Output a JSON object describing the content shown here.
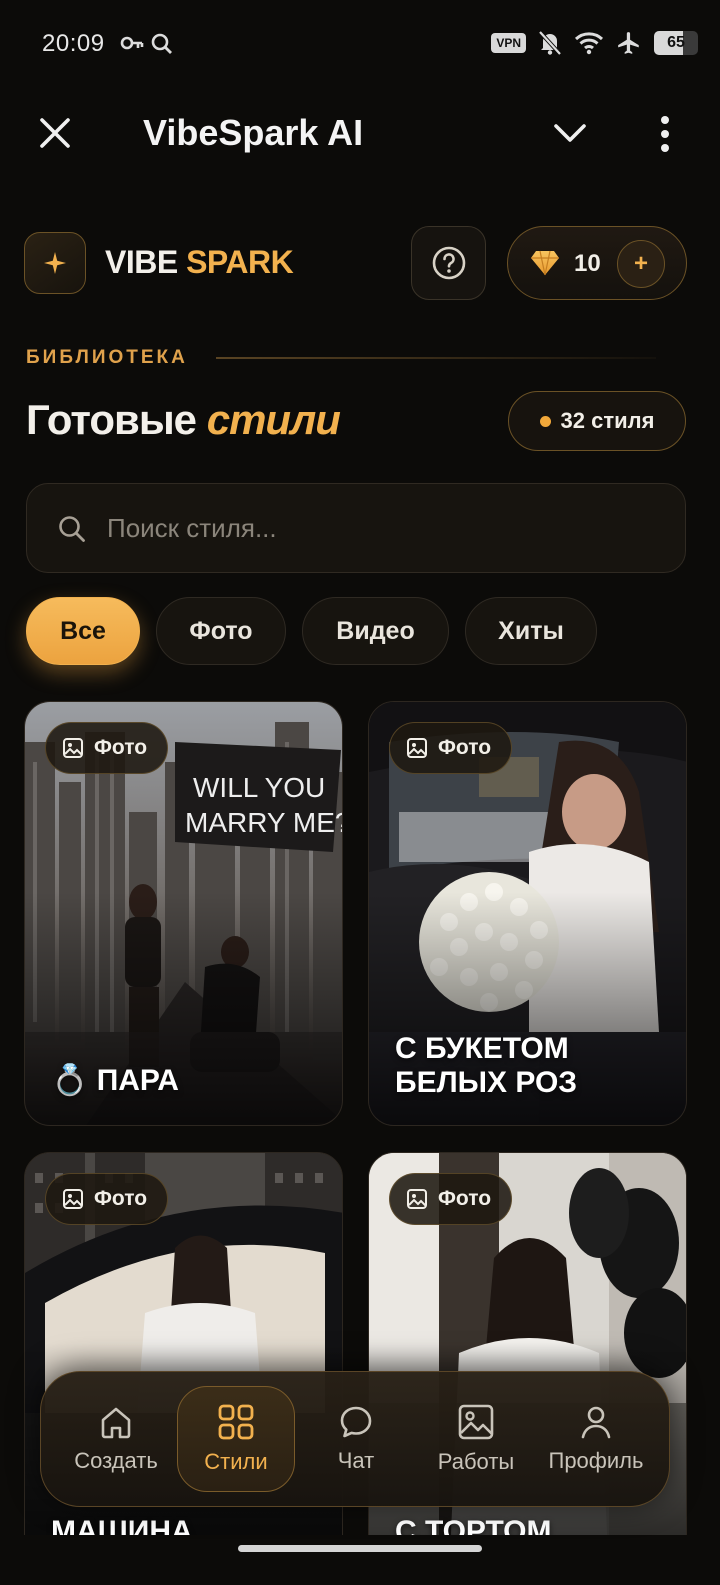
{
  "status_bar": {
    "time": "20:09",
    "vpn_label": "VPN",
    "battery": "65",
    "battery_level": 0.65
  },
  "header": {
    "title": "VibeSpark AI"
  },
  "brand": {
    "word_a": "VIBE",
    "word_b": "SPARK",
    "credits": "10",
    "add_symbol": "+"
  },
  "library": {
    "eyebrow": "БИБЛИОТЕКА",
    "heading_a": "Готовые",
    "heading_b": "стили",
    "count": "32 стиля"
  },
  "search": {
    "placeholder": "Поиск стиля..."
  },
  "filters": [
    {
      "label": "Все",
      "active": true
    },
    {
      "label": "Фото",
      "active": false
    },
    {
      "label": "Видео",
      "active": false
    },
    {
      "label": "Хиты",
      "active": false
    }
  ],
  "cards": [
    {
      "badge": "Фото",
      "emoji": "💍",
      "title": "ПАРА"
    },
    {
      "badge": "Фото",
      "title_line1": "С БУКЕТОМ",
      "title_line2": "БЕЛЫХ РОЗ"
    },
    {
      "badge": "Фото",
      "title": "МАШИНА"
    },
    {
      "badge": "Фото",
      "title": "С ТОРТОМ"
    }
  ],
  "nav": [
    {
      "label": "Создать",
      "icon": "home-icon"
    },
    {
      "label": "Стили",
      "icon": "grid-icon",
      "active": true
    },
    {
      "label": "Чат",
      "icon": "chat-icon"
    },
    {
      "label": "Работы",
      "icon": "image-icon"
    },
    {
      "label": "Профиль",
      "icon": "user-icon"
    }
  ],
  "colors": {
    "accent": "#f2b14e",
    "background": "#0c0b09",
    "surface": "#17140f"
  }
}
